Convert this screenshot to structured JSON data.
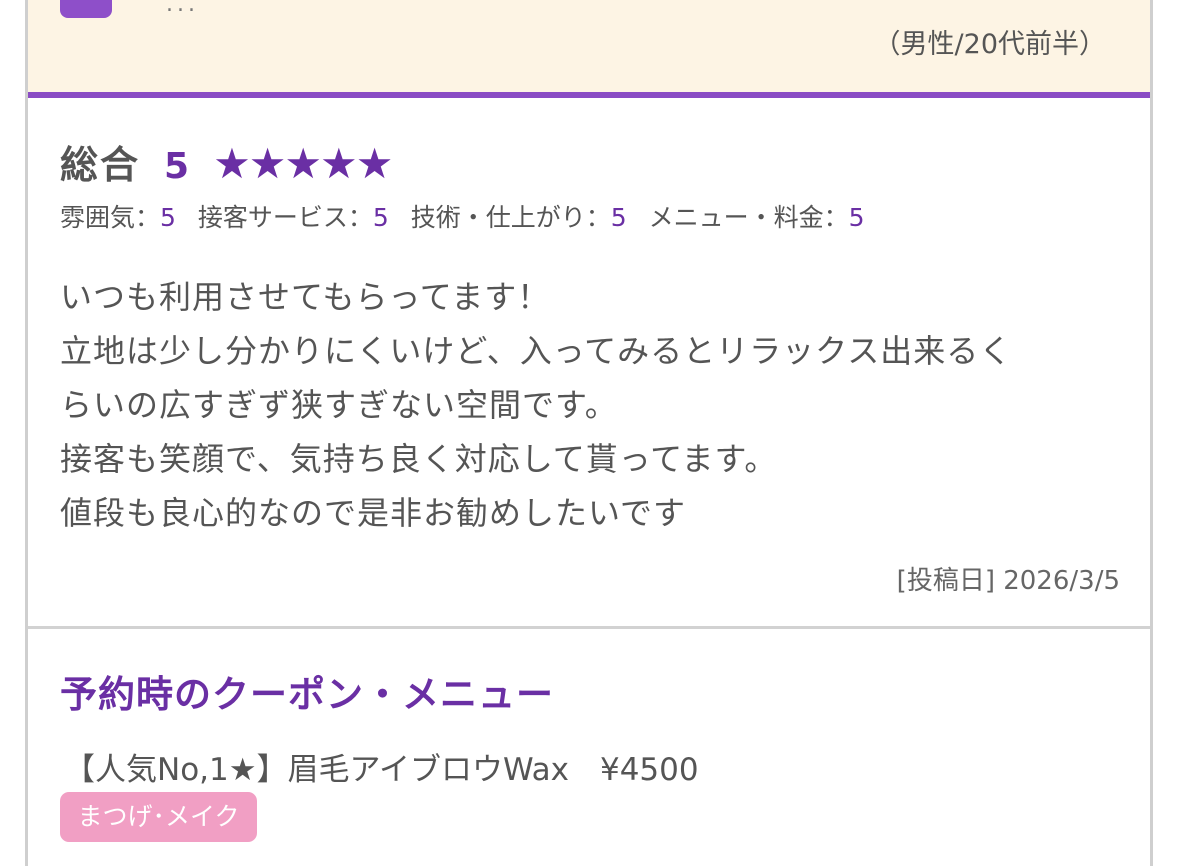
{
  "user": {
    "name_masked": "...",
    "attributes": "（男性/20代前半）"
  },
  "review": {
    "overall_label": "総合",
    "overall_score": "5",
    "stars": "★★★★★",
    "sub_ratings": [
      {
        "label": "雰囲気：",
        "value": "5"
      },
      {
        "label": "接客サービス：",
        "value": "5"
      },
      {
        "label": "技術・仕上がり：",
        "value": "5"
      },
      {
        "label": "メニュー・料金：",
        "value": "5"
      }
    ],
    "body_lines": [
      "いつも利用させてもらってます！",
      "立地は少し分かりにくいけど、入ってみるとリラックス出来るく",
      "らいの広すぎず狭すぎない空間です。",
      "接客も笑顔で、気持ち良く対応して貰ってます。",
      "値段も良心的なので是非お勧めしたいです"
    ],
    "post_date": "[投稿日] 2026/3/5"
  },
  "coupon": {
    "title": "予約時のクーポン・メニュー",
    "item": "【人気No,1★】眉毛アイブロウWax　¥4500",
    "tag": "まつげ･メイク"
  },
  "colors": {
    "accent_purple": "#6a2fa4",
    "band_background": "#fdf4e4",
    "tag_pink": "#f19fc4"
  }
}
